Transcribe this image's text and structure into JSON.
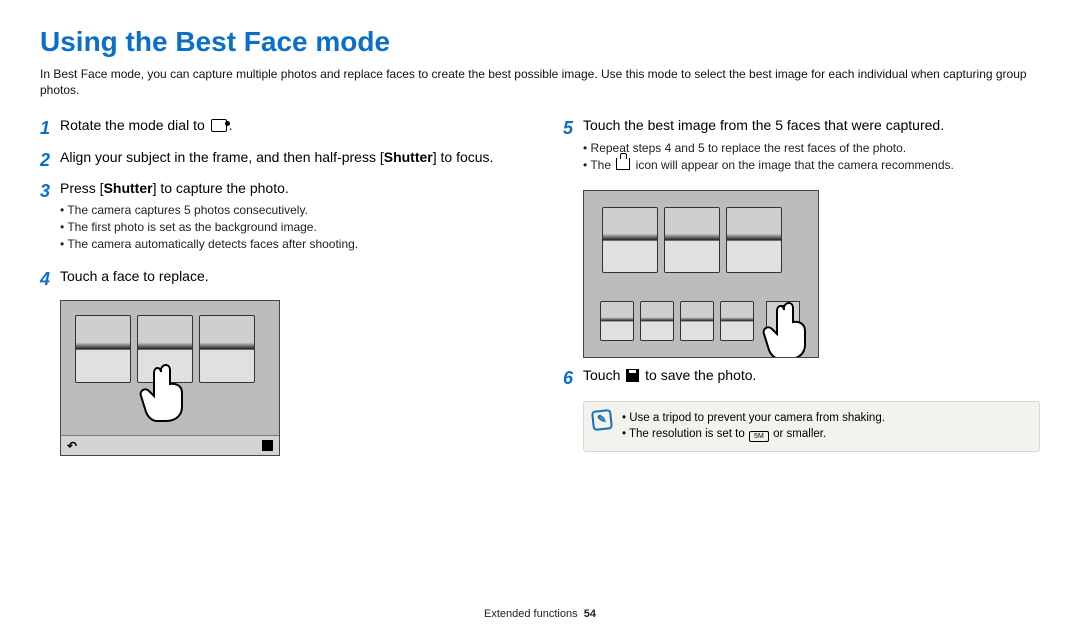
{
  "title": "Using the Best Face mode",
  "intro": "In Best Face mode, you can capture multiple photos and replace faces to create the best possible image. Use this mode to select the best image for each individual when capturing group photos.",
  "steps": {
    "s1": {
      "num": "1",
      "a": "Rotate the mode dial to ",
      "b": "."
    },
    "s2": {
      "num": "2",
      "a": "Align your subject in the frame, and then half-press [",
      "b": "Shutter",
      "c": "] to focus."
    },
    "s3": {
      "num": "3",
      "a": "Press [",
      "b": "Shutter",
      "c": "] to capture the photo.",
      "sub": [
        "The camera captures 5 photos consecutively.",
        "The first photo is set as the background image.",
        "The camera automatically detects faces after shooting."
      ]
    },
    "s4": {
      "num": "4",
      "a": "Touch a face to replace."
    },
    "s5": {
      "num": "5",
      "a": "Touch the best image from the 5 faces that were captured.",
      "sub_a": "Repeat steps 4 and 5 to replace the rest faces of the photo.",
      "sub_b1": "The ",
      "sub_b2": " icon will appear on the image that the camera recommends."
    },
    "s6": {
      "num": "6",
      "a": "Touch ",
      "b": " to save the photo."
    }
  },
  "note": {
    "li1": "Use a tripod to prevent your camera from shaking.",
    "li2a": "The resolution is set to ",
    "li2b": " or smaller.",
    "res_label": "5M"
  },
  "footer": {
    "section": "Extended functions",
    "page": "54"
  }
}
